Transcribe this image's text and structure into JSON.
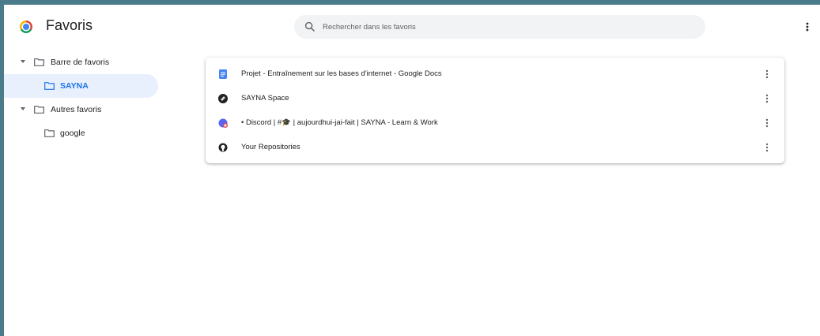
{
  "header": {
    "title": "Favoris",
    "search_placeholder": "Rechercher dans les favoris"
  },
  "sidebar": {
    "items": [
      {
        "label": "Barre de favoris",
        "expanded": true,
        "selected": false
      },
      {
        "label": "SAYNA",
        "selected": true
      },
      {
        "label": "Autres favoris",
        "expanded": true,
        "selected": false
      },
      {
        "label": "google",
        "selected": false
      }
    ]
  },
  "bookmarks": [
    {
      "title": "Projet - Entraînement sur les bases d'internet - Google Docs",
      "icon": "google-docs-icon"
    },
    {
      "title": "SAYNA Space",
      "icon": "sayna-space-icon"
    },
    {
      "title": "• Discord | #🎓 | aujourdhui-jai-fait | SAYNA - Learn & Work",
      "icon": "discord-icon"
    },
    {
      "title": "Your Repositories",
      "icon": "github-icon"
    }
  ],
  "colors": {
    "accent": "#1a73e8",
    "selected_bg": "#e8f0fe",
    "page_border": "#4a7b8a"
  }
}
